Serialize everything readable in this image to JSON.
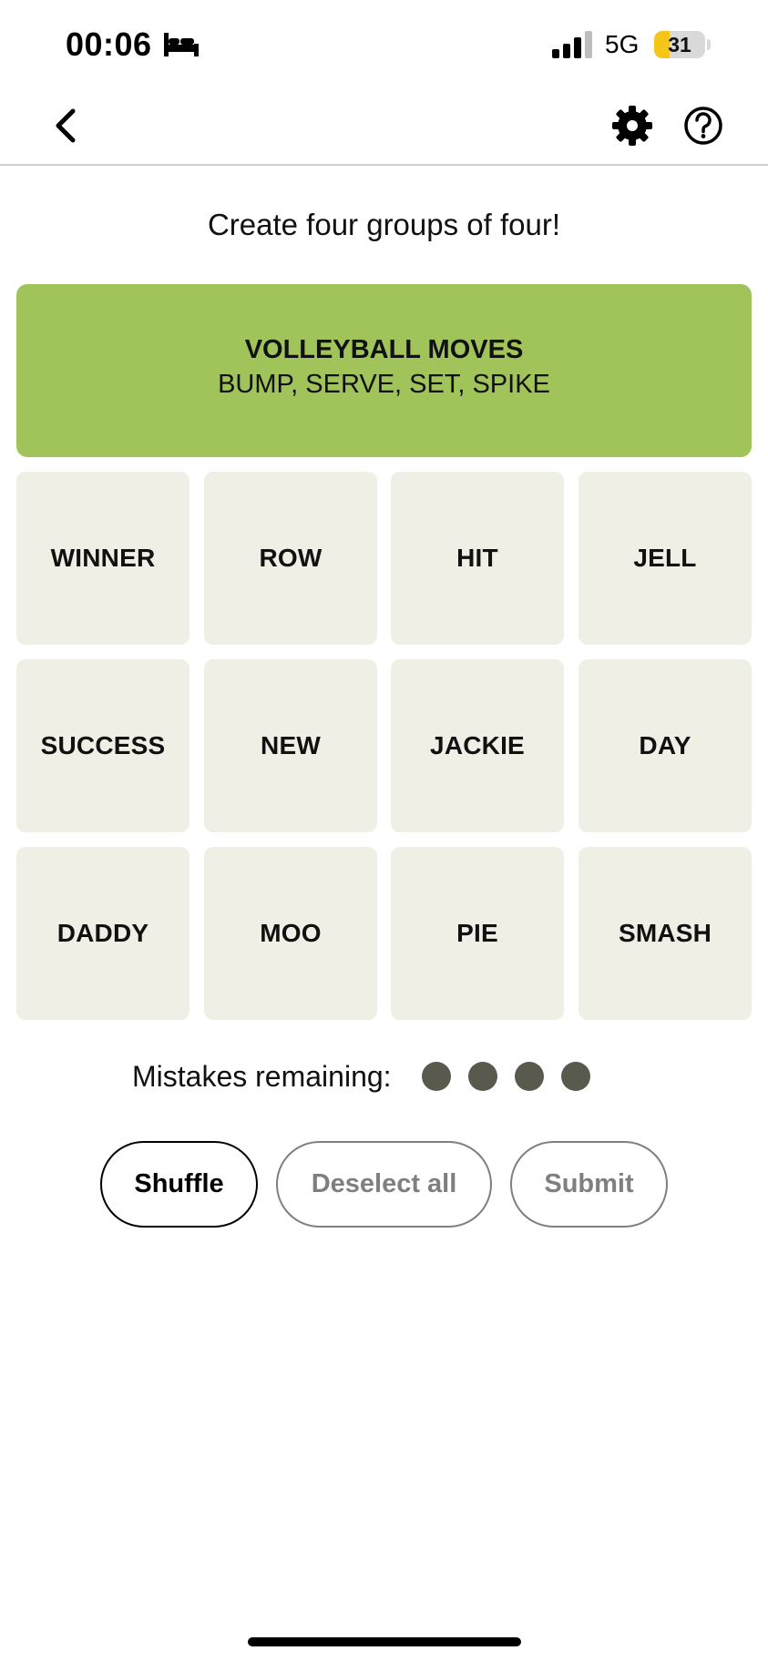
{
  "status_bar": {
    "time": "00:06",
    "network": "5G",
    "battery_level": "31",
    "battery_fraction": 0.31,
    "icons": [
      "bed-icon",
      "signal-icon",
      "battery-icon"
    ]
  },
  "header": {
    "icons": [
      "chevron-left-icon",
      "gear-icon",
      "question-circle-icon"
    ]
  },
  "instructions": "Create four groups of four!",
  "solved_group": {
    "title": "VOLLEYBALL MOVES",
    "words": "BUMP, SERVE, SET, SPIKE",
    "color": "#a0c35a"
  },
  "tiles": [
    "WINNER",
    "ROW",
    "HIT",
    "JELL",
    "SUCCESS",
    "NEW",
    "JACKIE",
    "DAY",
    "DADDY",
    "MOO",
    "PIE",
    "SMASH"
  ],
  "mistakes": {
    "label": "Mistakes remaining:",
    "remaining": 4
  },
  "buttons": {
    "shuffle": "Shuffle",
    "deselect_all": "Deselect all",
    "submit": "Submit"
  },
  "colors": {
    "tile_bg": "#efefe6",
    "dot": "#5a594e",
    "battery_fill": "#f5c518",
    "disabled": "#7f7f7f"
  }
}
